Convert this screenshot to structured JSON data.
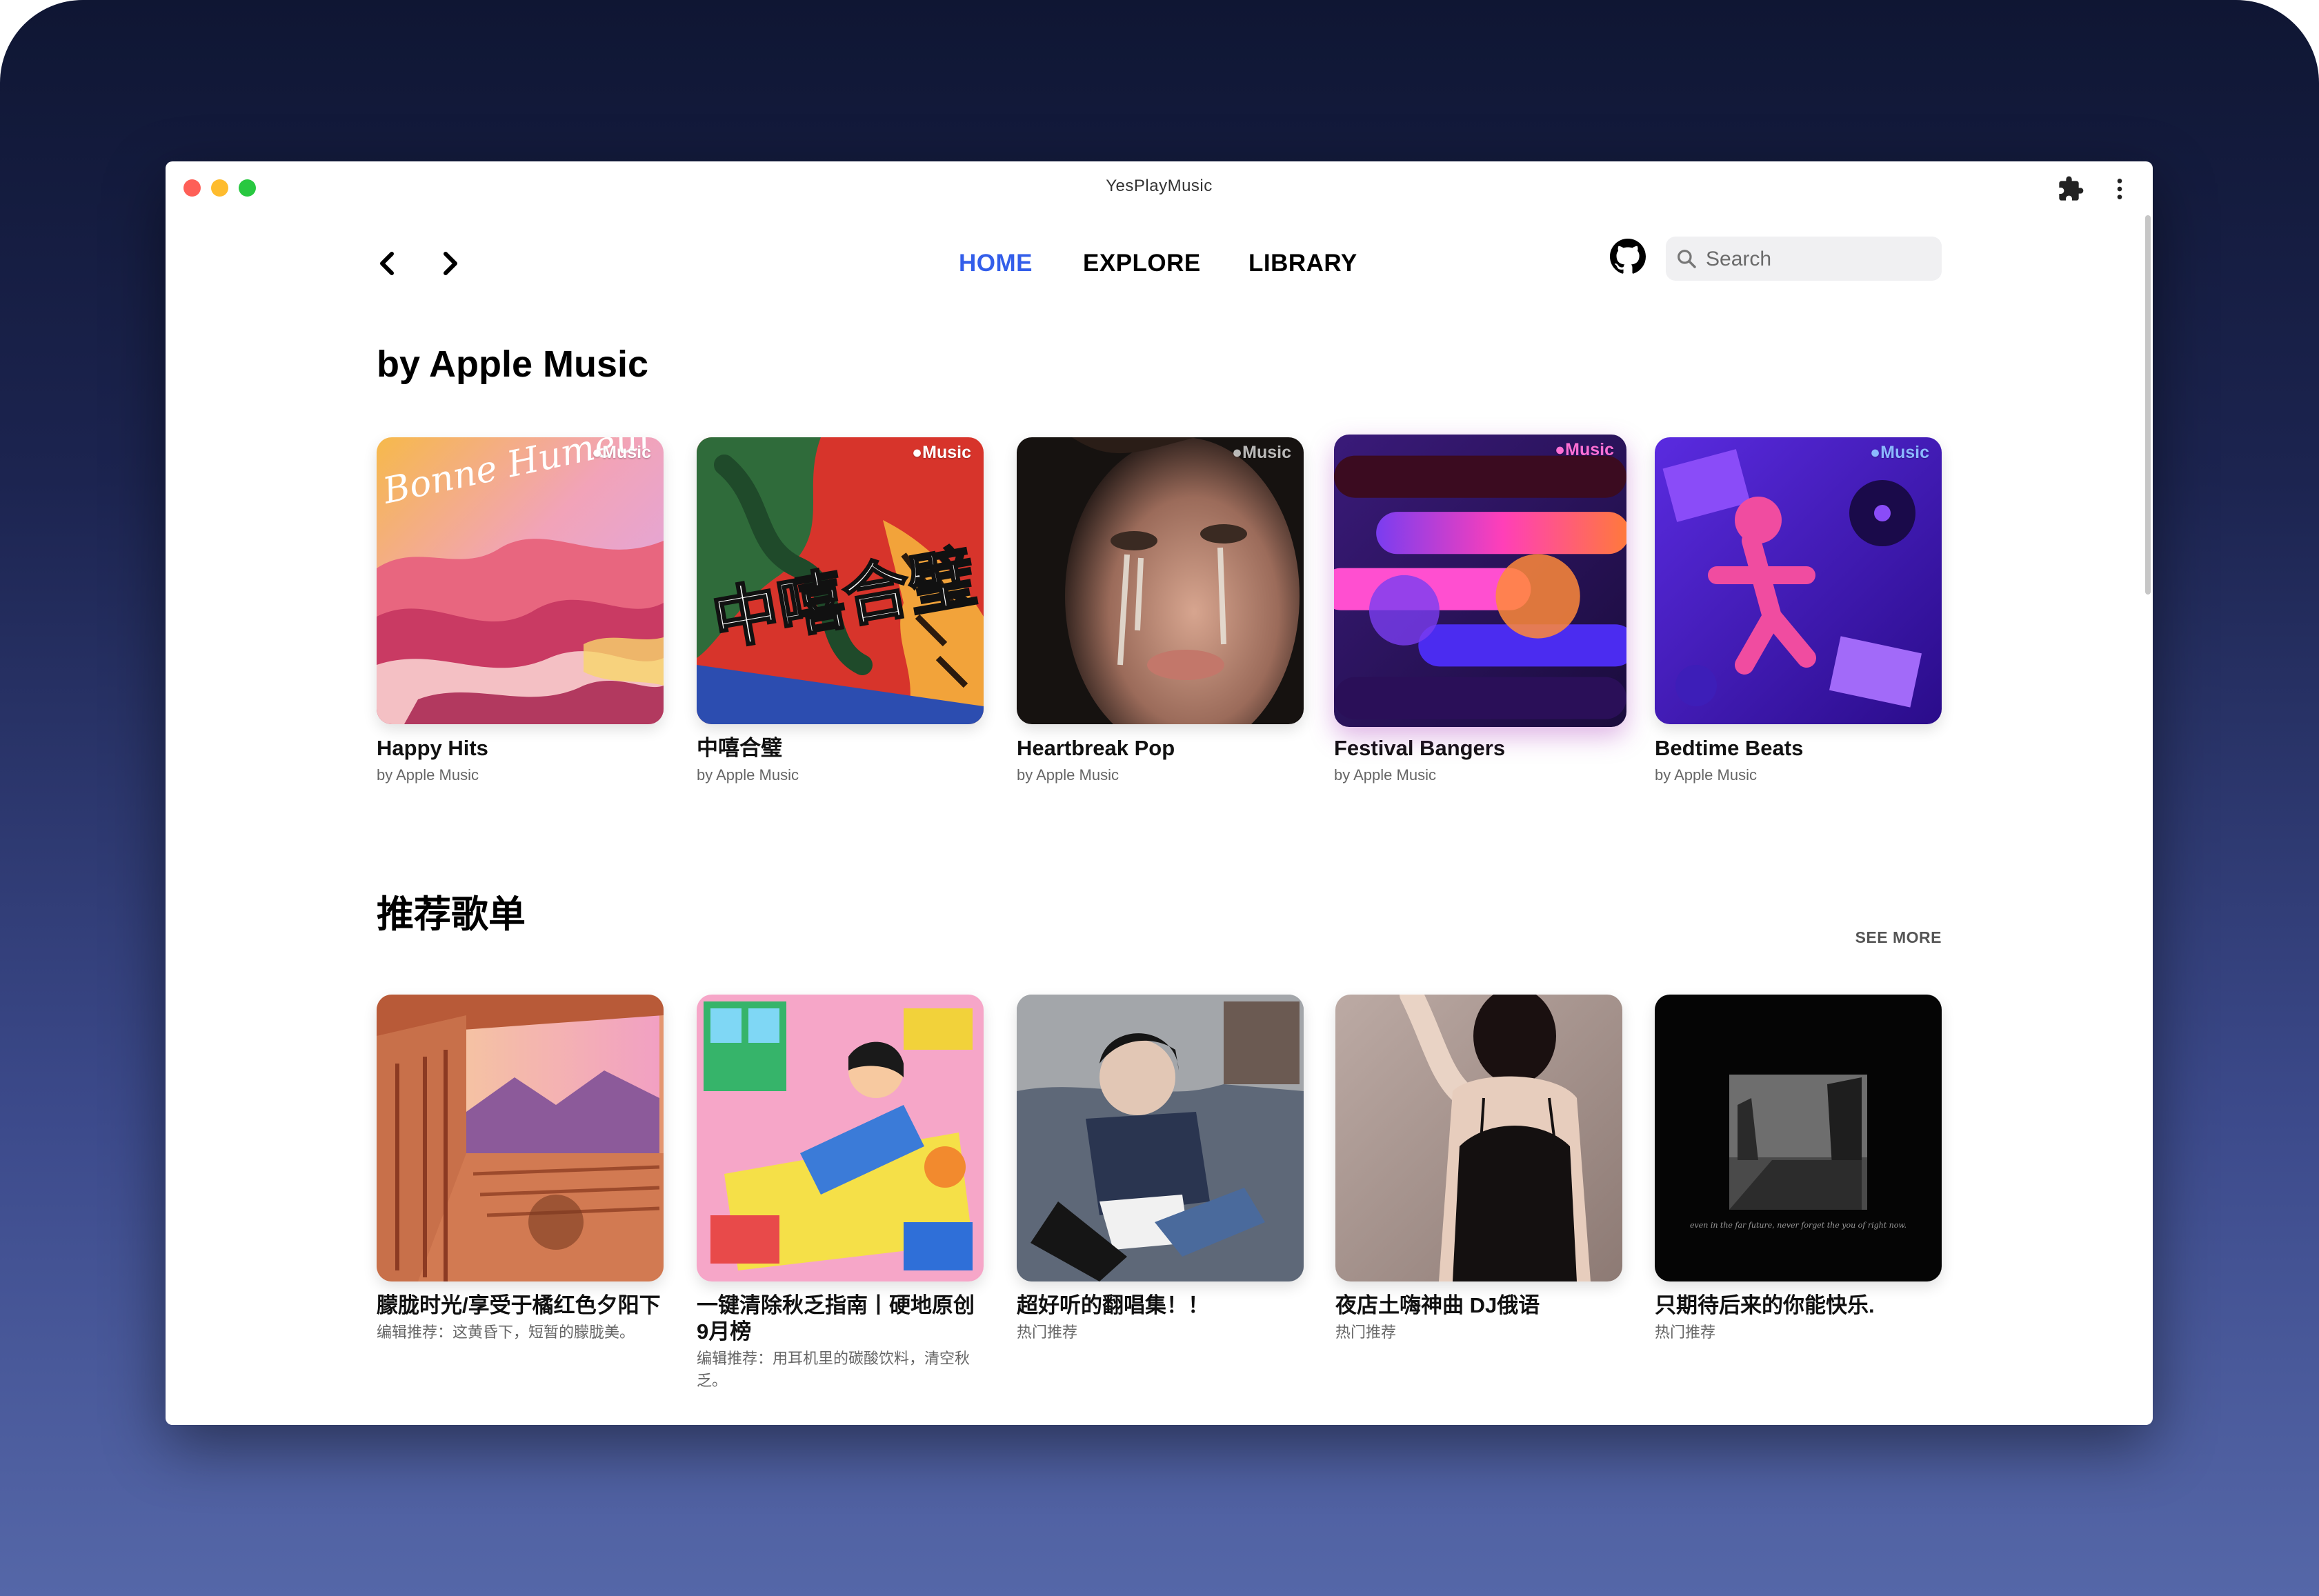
{
  "window": {
    "title": "YesPlayMusic"
  },
  "nav": {
    "tabs": [
      {
        "label": "HOME",
        "active": true
      },
      {
        "label": "EXPLORE",
        "active": false
      },
      {
        "label": "LIBRARY",
        "active": false
      }
    ],
    "search_placeholder": "Search"
  },
  "colors": {
    "accent": "#335eea",
    "desktop_top": "#0f1633",
    "desktop_bottom": "#5567a8"
  },
  "icons": [
    "close-icon",
    "minimize-icon",
    "maximize-icon",
    "extension-icon",
    "more-vert-icon",
    "chevron-left-icon",
    "chevron-right-icon",
    "github-icon",
    "search-icon"
  ],
  "apple_section": {
    "title": "by Apple Music",
    "badge": "Music",
    "items": [
      {
        "title": "Happy Hits",
        "subtitle": "by Apple Music",
        "cover_text": "Bonne Humeur"
      },
      {
        "title": "中嘻合璧",
        "subtitle": "by Apple Music",
        "cover_text": "中嘻合璧"
      },
      {
        "title": "Heartbreak Pop",
        "subtitle": "by Apple Music"
      },
      {
        "title": "Festival Bangers",
        "subtitle": "by Apple Music"
      },
      {
        "title": "Bedtime Beats",
        "subtitle": "by Apple Music"
      }
    ]
  },
  "recommend_section": {
    "title": "推荐歌单",
    "see_more": "SEE MORE",
    "items": [
      {
        "title": "朦胧时光/享受于橘红色夕阳下",
        "subtitle": "编辑推荐：这黄昏下，短暂的朦胧美。"
      },
      {
        "title": "一键清除秋乏指南丨硬地原创9月榜",
        "subtitle": "编辑推荐：用耳机里的碳酸饮料，清空秋乏。"
      },
      {
        "title": "超好听的翻唱集！！",
        "subtitle": "热门推荐"
      },
      {
        "title": "夜店土嗨神曲 DJ俄语",
        "subtitle": "热门推荐"
      },
      {
        "title": "只期待后来的你能快乐.",
        "subtitle": "热门推荐",
        "cover_text": "even in the far future, never forget the you of right now."
      }
    ]
  }
}
